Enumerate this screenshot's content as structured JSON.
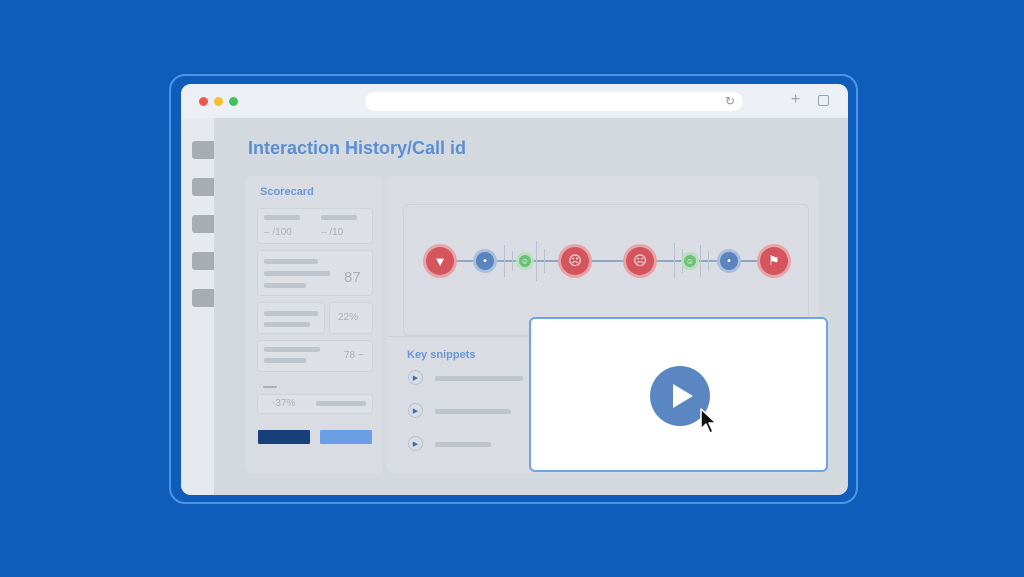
{
  "page": {
    "title": "Interaction History/Call id"
  },
  "browser": {
    "reload_icon": "reload-icon",
    "new_tab_icon": "plus-icon",
    "tabs_icon": "tabs-icon"
  },
  "scorecard": {
    "title": "Scorecard",
    "score_a": "– /100",
    "score_b": "– /10",
    "value_main": "87",
    "value_pct": "22%",
    "value_trend": "78 ~",
    "value_change": "-37%"
  },
  "snippets": {
    "title": "Key snippets",
    "play_icon": "play-icon"
  },
  "timeline": {
    "nodes": [
      "thumbs-down-icon",
      "lightbulb-icon",
      "smile-icon",
      "frown-icon",
      "frown-icon",
      "smile-icon",
      "lightbulb-icon",
      "flag-icon"
    ]
  },
  "video": {
    "play_icon": "play-icon",
    "cursor_icon": "cursor-icon"
  },
  "colors": {
    "background": "#0f5dbb",
    "accent": "#5b8fd4",
    "negative": "#d4555e",
    "neutral": "#5a84c0",
    "positive": "#6cc177"
  }
}
